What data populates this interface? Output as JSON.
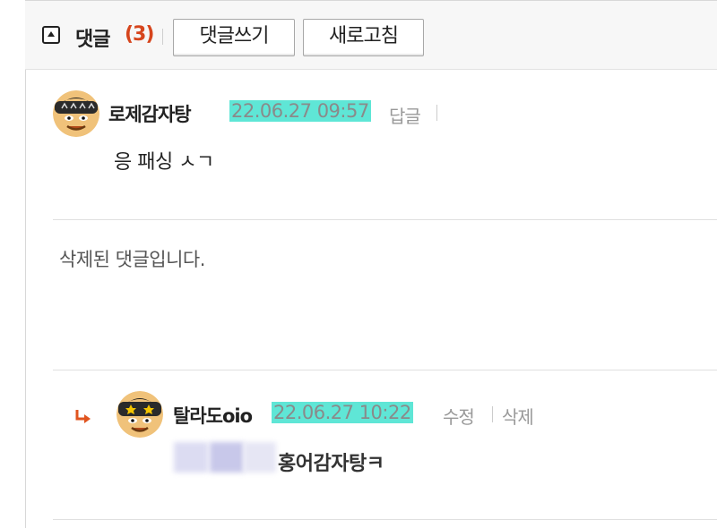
{
  "header": {
    "title": "댓글",
    "count": "(3)",
    "write_button": "댓글쓰기",
    "refresh_button": "새로고침"
  },
  "comments": [
    {
      "nickname": "로제감자탕",
      "date": "22.06.27 09:57",
      "reply_label": "답글",
      "text": "응 패싱 ㅅㄱ"
    },
    {
      "deleted_text": "삭제된 댓글입니다."
    },
    {
      "nickname": "탈라도oio",
      "date": "22.06.27 10:22",
      "edit_label": "수정",
      "delete_label": "삭제",
      "text": "홍어감자탕ㅋ"
    }
  ],
  "colors": {
    "count": "#d6451d",
    "date_highlight": "#5fe6d6",
    "reply_arrow": "#e0541f"
  }
}
